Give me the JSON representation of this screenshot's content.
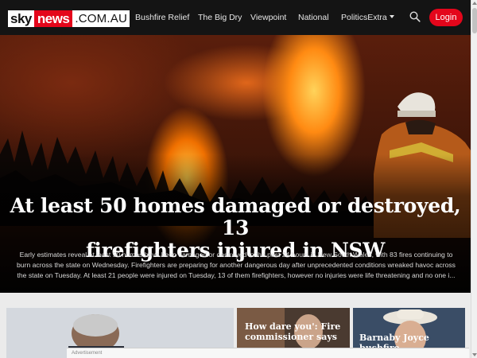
{
  "brand": {
    "sky": "sky",
    "news": "news",
    "domain": ".COM.AU"
  },
  "nav": [
    {
      "label": "Bushfire Relief"
    },
    {
      "label": "The Big Dry"
    },
    {
      "label": "Viewpoint"
    },
    {
      "label": "National"
    },
    {
      "label": "PoliticsExtra"
    }
  ],
  "header": {
    "login_label": "Login",
    "search_icon": "search-icon"
  },
  "hero": {
    "headline_line1": "At least 50 homes damaged or destroyed, 13",
    "headline_line2": "firefighters injured in NSW",
    "summary": "Early estimates reveal at least 50 homes have been damaged or destroyed in the past 24 hours in New South Wales, with 83 fires continuing to burn across the state on Wednesday. Firefighters are preparing for another dangerous day after unprecedented conditions wreaked havoc across the state on Tuesday. At least 21 people were injured on Tuesday, 13 of them firefighters, however no injuries were life threatening and no one i..."
  },
  "stories": [
    {
      "title": ""
    },
    {
      "title_line1": "How dare you': Fire",
      "title_line2": "commissioner says"
    },
    {
      "title_line1": "Barnaby Joyce",
      "title_line2": "bushfire"
    }
  ],
  "ticker": {
    "text": "Advertisement"
  },
  "colors": {
    "brand_red": "#e4061b",
    "header_bg": "#141414"
  }
}
